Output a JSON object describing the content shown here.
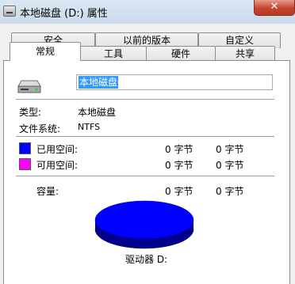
{
  "window": {
    "title": "本地磁盘 (D:) 属性",
    "close_glyph": "✕"
  },
  "tabs_back": [
    {
      "label": "安全"
    },
    {
      "label": "以前的版本"
    },
    {
      "label": "自定义"
    }
  ],
  "tabs_front": [
    {
      "label": "常规"
    },
    {
      "label": "工具"
    },
    {
      "label": "硬件"
    },
    {
      "label": "共享"
    }
  ],
  "active_tab": "常规",
  "drive": {
    "name_value": "本地磁盘",
    "type_label": "类型:",
    "type_value": "本地磁盘",
    "fs_label": "文件系统:",
    "fs_value": "NTFS"
  },
  "space": {
    "used_label": "已用空间:",
    "used_bytes": "0 字节",
    "used_size": "0 字节",
    "used_color": "#0000ff",
    "free_label": "可用空间:",
    "free_bytes": "0 字节",
    "free_size": "0 字节",
    "free_color": "#ff00ff",
    "capacity_label": "容量:",
    "capacity_bytes": "0 字节",
    "capacity_size": "0 字节"
  },
  "drive_label": "驱动器 D:"
}
